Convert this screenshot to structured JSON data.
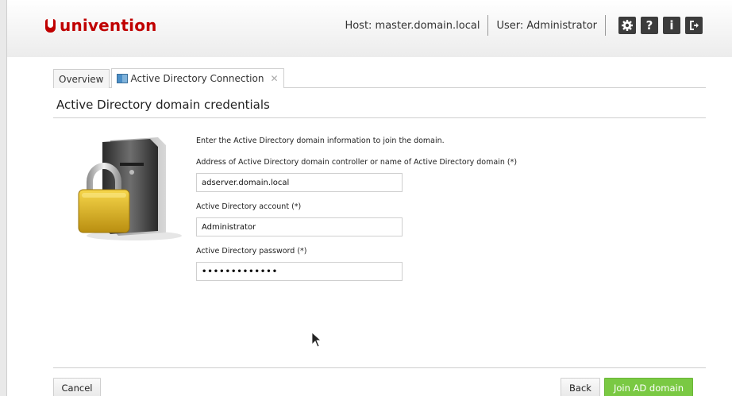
{
  "header": {
    "logo_text": "univention",
    "host_text": "Host: master.domain.local",
    "user_text": "User: Administrator",
    "icons": [
      "gear-icon",
      "help-icon",
      "info-icon",
      "logout-icon"
    ],
    "help_glyph": "?",
    "info_glyph": "i"
  },
  "tabs": [
    {
      "label": "Overview"
    },
    {
      "label": "Active Directory Connection",
      "close": "✕"
    }
  ],
  "main": {
    "title": "Active Directory domain credentials",
    "intro": "Enter the Active Directory domain information to join the domain.",
    "fields": [
      {
        "label": "Address of Active Directory domain controller or name of Active Directory domain (*)",
        "value": "adserver.domain.local"
      },
      {
        "label": "Active Directory account (*)",
        "value": "Administrator"
      },
      {
        "label": "Active Directory password (*)",
        "value": "•••••••••••••"
      }
    ]
  },
  "buttons": {
    "cancel": "Cancel",
    "back": "Back",
    "join": "Join AD domain"
  },
  "colors": {
    "brand": "#c00000",
    "primary_button": "#7ac943"
  }
}
